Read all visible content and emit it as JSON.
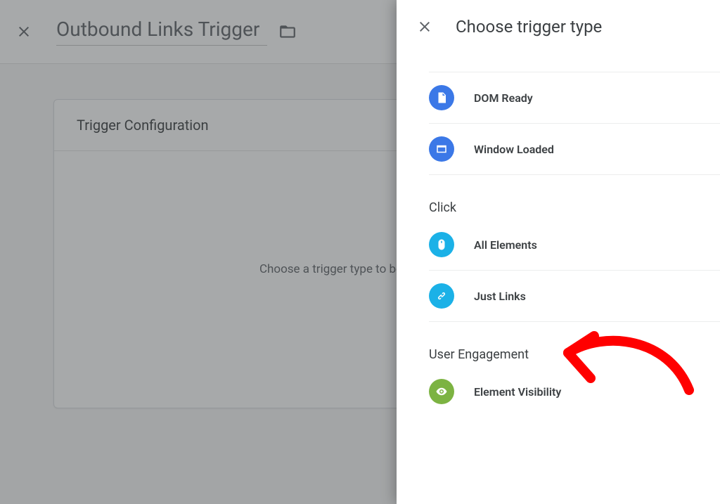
{
  "main": {
    "title": "Outbound Links Trigger",
    "card_title": "Trigger Configuration",
    "placeholder": "Choose a trigger type to begin setup..."
  },
  "panel": {
    "title": "Choose trigger type",
    "groups": [
      {
        "label": "",
        "items": [
          {
            "name": "",
            "icon": "partial",
            "color": "blue"
          },
          {
            "name": "DOM Ready",
            "icon": "file",
            "color": "blue"
          },
          {
            "name": "Window Loaded",
            "icon": "window",
            "color": "blue"
          }
        ]
      },
      {
        "label": "Click",
        "items": [
          {
            "name": "All Elements",
            "icon": "mouse",
            "color": "cyan"
          },
          {
            "name": "Just Links",
            "icon": "link",
            "color": "cyan"
          }
        ]
      },
      {
        "label": "User Engagement",
        "items": [
          {
            "name": "Element Visibility",
            "icon": "eye",
            "color": "green"
          }
        ]
      }
    ]
  }
}
